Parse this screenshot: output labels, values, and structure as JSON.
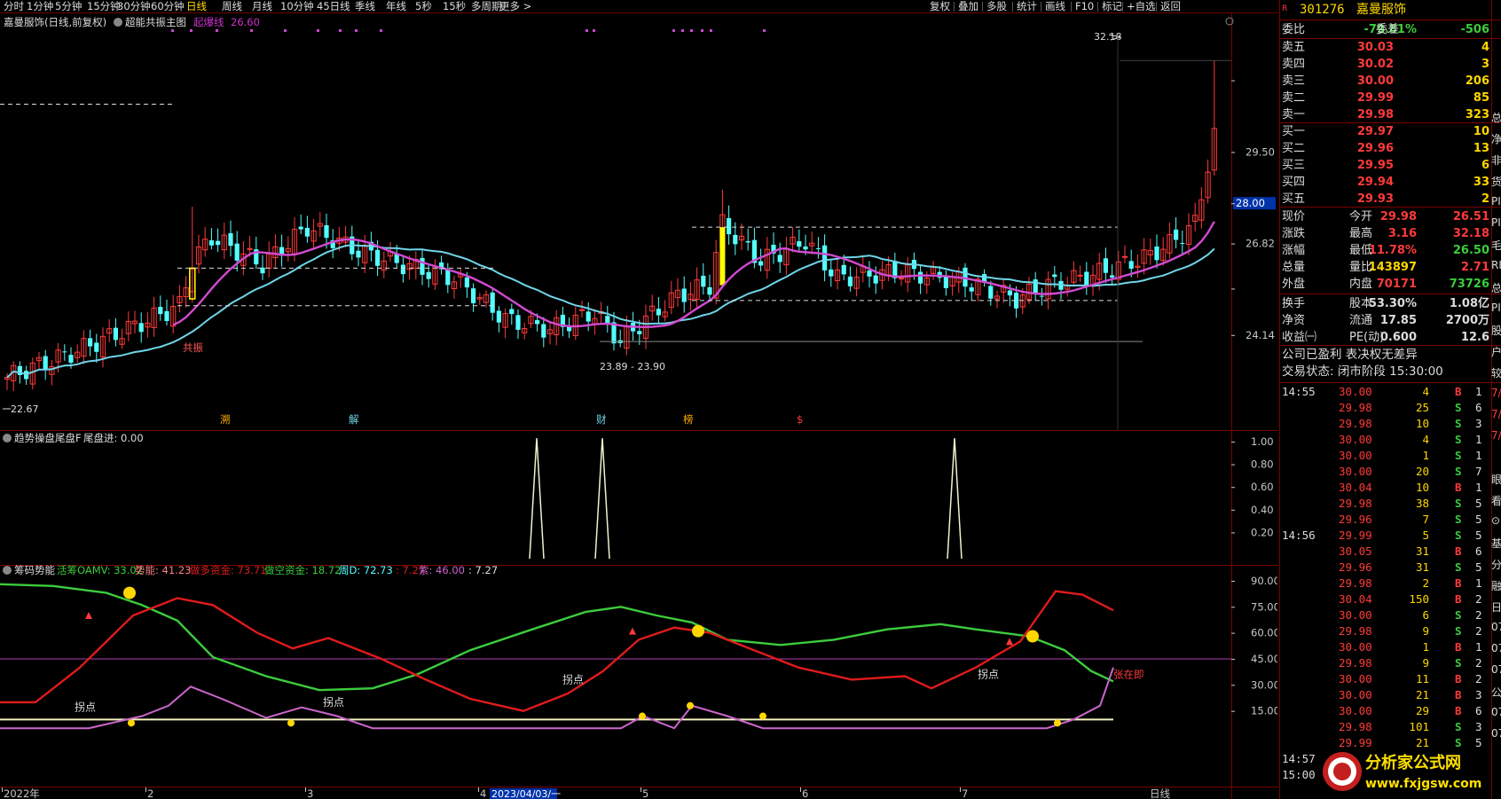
{
  "toolbar": {
    "periods": [
      "分时",
      "1分钟",
      "5分钟",
      "15分钟",
      "30分钟",
      "60分钟",
      "日线",
      "周线",
      "月线",
      "10分钟",
      "45日线",
      "季线",
      "年线",
      "5秒",
      "15秒",
      "多周期",
      "更多 >"
    ],
    "right": [
      "复权",
      "叠加",
      "多股",
      "统计",
      "画线",
      "F10",
      "标记",
      "+自选",
      "返回"
    ]
  },
  "main": {
    "title": "嘉曼服饰(日线,前复权)",
    "indicator": "超能共振主图",
    "line_label": "起爆线",
    "line_value": "26.60",
    "y_labels": [
      "29.50",
      "28.00",
      "26.82",
      "24.14"
    ],
    "high_label": "32.18",
    "low_label": "22.67",
    "range_label": "23.89 - 23.90",
    "resonance_text": "共振",
    "markers": [
      "溯",
      "解",
      "财",
      "榜",
      "$"
    ]
  },
  "sub1": {
    "title": "趋势操盘尾盘F",
    "field": "尾盘进: 0.00",
    "y_labels": [
      "1.00",
      "0.80",
      "0.60",
      "0.40",
      "0.20"
    ]
  },
  "sub2": {
    "title": "筹码势能",
    "f1": "活筹OAMV: 33.02",
    "f2": "势能: 41.23",
    "f3": "做多资金: 73.71",
    "f4": "做空资金: 18.72",
    "f5": "周D: 72.73",
    "f6": ": 7.27",
    "f7": "紫: 46.00",
    "f8": ": 7.27",
    "y_labels": [
      "90.00",
      "75.00",
      "60.00",
      "45.00",
      "30.00",
      "15.00"
    ],
    "annotations": [
      "拐点",
      "拐点",
      "拐点",
      "拐点"
    ],
    "note": "张在即"
  },
  "xaxis": {
    "labels": [
      "2022年",
      "2",
      "3",
      "4",
      "5",
      "6",
      "7"
    ],
    "cursor_date": "2023/04/03/一",
    "period": "日线"
  },
  "chart_data": {
    "type": "candlestick",
    "y_range": [
      22.2,
      33.2
    ],
    "series": [
      {
        "name": "起爆线",
        "color": "#cc33cc"
      },
      {
        "name": "做多资金",
        "color": "#e01b1b"
      },
      {
        "name": "做空资金",
        "color": "#3ccc3c"
      },
      {
        "name": "紫",
        "color": "#cc66cc"
      }
    ]
  },
  "quote": {
    "code": "301276",
    "name": "嘉曼服饰",
    "weibi_label": "委比",
    "weibi": "-79.81%",
    "weicha_label": "委差",
    "weicha": "-506",
    "asks": [
      {
        "label": "卖五",
        "price": "30.03",
        "vol": "4"
      },
      {
        "label": "卖四",
        "price": "30.02",
        "vol": "3"
      },
      {
        "label": "卖三",
        "price": "30.00",
        "vol": "206"
      },
      {
        "label": "卖二",
        "price": "29.99",
        "vol": "85"
      },
      {
        "label": "卖一",
        "price": "29.98",
        "vol": "323"
      }
    ],
    "bids": [
      {
        "label": "买一",
        "price": "29.97",
        "vol": "10"
      },
      {
        "label": "买二",
        "price": "29.96",
        "vol": "13"
      },
      {
        "label": "买三",
        "price": "29.95",
        "vol": "6"
      },
      {
        "label": "买四",
        "price": "29.94",
        "vol": "33"
      },
      {
        "label": "买五",
        "price": "29.93",
        "vol": "2"
      }
    ],
    "stats": [
      {
        "l": "现价",
        "v": "29.98",
        "c": "#ff3a3a",
        "l2": "今开",
        "v2": "26.51",
        "c2": "#ff3a3a"
      },
      {
        "l": "涨跌",
        "v": "3.16",
        "c": "#ff3a3a",
        "l2": "最高",
        "v2": "32.18",
        "c2": "#ff3a3a"
      },
      {
        "l": "涨幅",
        "v": "11.78%",
        "c": "#ff3a3a",
        "l2": "最低",
        "v2": "26.50",
        "c2": "#3ccc3c"
      },
      {
        "l": "总量",
        "v": "143897",
        "c": "#ffd700",
        "l2": "量比",
        "v2": "2.71",
        "c2": "#ff3a3a"
      },
      {
        "l": "外盘",
        "v": "70171",
        "c": "#ff3a3a",
        "l2": "内盘",
        "v2": "73726",
        "c2": "#3ccc3c"
      }
    ],
    "stats2": [
      {
        "l": "换手",
        "v": "53.30%",
        "c": "#dcdcdc",
        "l2": "股本",
        "v2": "1.08亿",
        "c2": "#dcdcdc"
      },
      {
        "l": "净资",
        "v": "17.85",
        "c": "#dcdcdc",
        "l2": "流通",
        "v2": "2700万",
        "c2": "#dcdcdc"
      },
      {
        "l": "收益㈠",
        "v": "0.600",
        "c": "#dcdcdc",
        "l2": "PE(动)",
        "v2": "12.6",
        "c2": "#dcdcdc"
      }
    ],
    "info1": "公司已盈利 表决权无差异",
    "info2": "交易状态: 闭市阶段 15:30:00"
  },
  "ticks": [
    {
      "t": "14:55",
      "p": "30.00",
      "v": "4",
      "bs": "B",
      "n": "1"
    },
    {
      "t": "",
      "p": "29.98",
      "v": "25",
      "bs": "S",
      "n": "6"
    },
    {
      "t": "",
      "p": "29.98",
      "v": "10",
      "bs": "S",
      "n": "3"
    },
    {
      "t": "",
      "p": "30.00",
      "v": "4",
      "bs": "S",
      "n": "1"
    },
    {
      "t": "",
      "p": "30.00",
      "v": "1",
      "bs": "S",
      "n": "1"
    },
    {
      "t": "",
      "p": "30.00",
      "v": "20",
      "bs": "S",
      "n": "7"
    },
    {
      "t": "",
      "p": "30.04",
      "v": "10",
      "bs": "B",
      "n": "1"
    },
    {
      "t": "",
      "p": "29.98",
      "v": "38",
      "bs": "S",
      "n": "5"
    },
    {
      "t": "",
      "p": "29.96",
      "v": "7",
      "bs": "S",
      "n": "5"
    },
    {
      "t": "14:56",
      "p": "29.99",
      "v": "5",
      "bs": "S",
      "n": "5"
    },
    {
      "t": "",
      "p": "30.05",
      "v": "31",
      "bs": "B",
      "n": "6"
    },
    {
      "t": "",
      "p": "29.96",
      "v": "31",
      "bs": "S",
      "n": "5"
    },
    {
      "t": "",
      "p": "29.98",
      "v": "2",
      "bs": "B",
      "n": "1"
    },
    {
      "t": "",
      "p": "30.04",
      "v": "150",
      "bs": "B",
      "n": "2"
    },
    {
      "t": "",
      "p": "30.00",
      "v": "6",
      "bs": "S",
      "n": "2"
    },
    {
      "t": "",
      "p": "29.98",
      "v": "9",
      "bs": "S",
      "n": "2"
    },
    {
      "t": "",
      "p": "30.00",
      "v": "1",
      "bs": "B",
      "n": "1"
    },
    {
      "t": "",
      "p": "29.98",
      "v": "9",
      "bs": "S",
      "n": "2"
    },
    {
      "t": "",
      "p": "30.00",
      "v": "11",
      "bs": "B",
      "n": "2"
    },
    {
      "t": "",
      "p": "30.00",
      "v": "21",
      "bs": "B",
      "n": "3"
    },
    {
      "t": "",
      "p": "30.00",
      "v": "29",
      "bs": "B",
      "n": "6"
    },
    {
      "t": "",
      "p": "29.98",
      "v": "101",
      "bs": "S",
      "n": "3"
    },
    {
      "t": "",
      "p": "29.99",
      "v": "21",
      "bs": "S",
      "n": "5"
    },
    {
      "t": "14:57",
      "p": "",
      "v": "",
      "bs": "",
      "n": ""
    },
    {
      "t": "15:00",
      "p": "",
      "v": "",
      "bs": "",
      "n": ""
    }
  ],
  "edge_chars": [
    "总",
    "净",
    "非",
    "货",
    "PI",
    "PI",
    "毛",
    "RI",
    "总",
    "PI",
    "股",
    "户",
    "较",
    "7/",
    "7/",
    "7/",
    "",
    "眼",
    "看",
    "⊙",
    "基",
    "分",
    "融",
    "日",
    "07",
    "07",
    "07",
    "公",
    "07",
    "07"
  ],
  "watermark": {
    "cn": "分析家公式网",
    "url": "www.fxjgsw.com"
  }
}
